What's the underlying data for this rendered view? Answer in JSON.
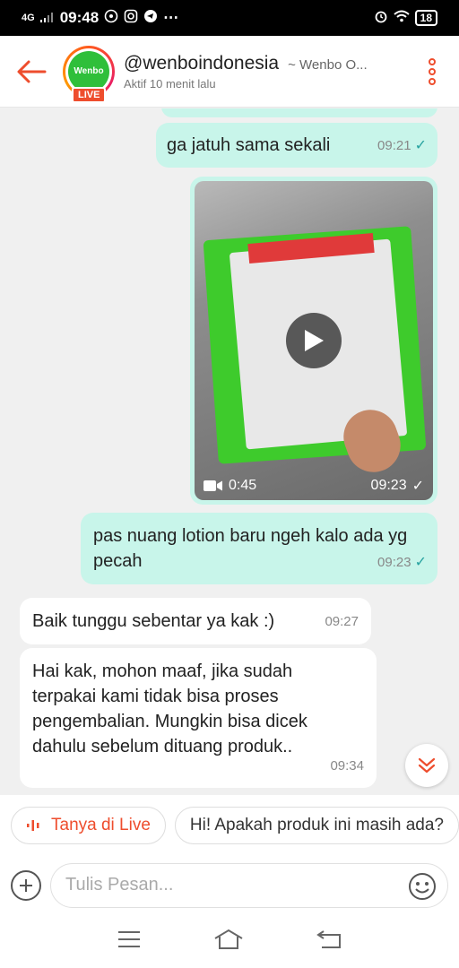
{
  "status_bar": {
    "network": "4G",
    "time": "09:48",
    "battery": "18"
  },
  "header": {
    "avatar_text": "Wenbo",
    "live_label": "LIVE",
    "username": "@wenboindonesia",
    "shop_name": "~ Wenbo O...",
    "last_active": "Aktif 10 menit lalu"
  },
  "messages": [
    {
      "direction": "out",
      "text": "ga jatuh sama sekali",
      "time": "09:21"
    },
    {
      "direction": "out",
      "type": "video",
      "duration": "0:45",
      "time": "09:23"
    },
    {
      "direction": "out",
      "text": "pas nuang lotion baru ngeh kalo ada yg pecah",
      "time": "09:23"
    },
    {
      "direction": "in",
      "text": "Baik tunggu sebentar ya kak :)",
      "time": "09:27"
    },
    {
      "direction": "in",
      "text": "Hai kak, mohon maaf, jika sudah terpakai kami tidak bisa proses pengembalian. Mungkin bisa dicek dahulu sebelum dituang produk..",
      "time": "09:34"
    }
  ],
  "quick_replies": {
    "live_chip": "Tanya di Live",
    "suggestion": "Hi! Apakah produk ini masih ada?"
  },
  "composer": {
    "placeholder": "Tulis Pesan..."
  },
  "colors": {
    "accent": "#ee4d2d",
    "outgoing_bubble": "#c8f5ea",
    "read_check": "#27a3a0"
  }
}
